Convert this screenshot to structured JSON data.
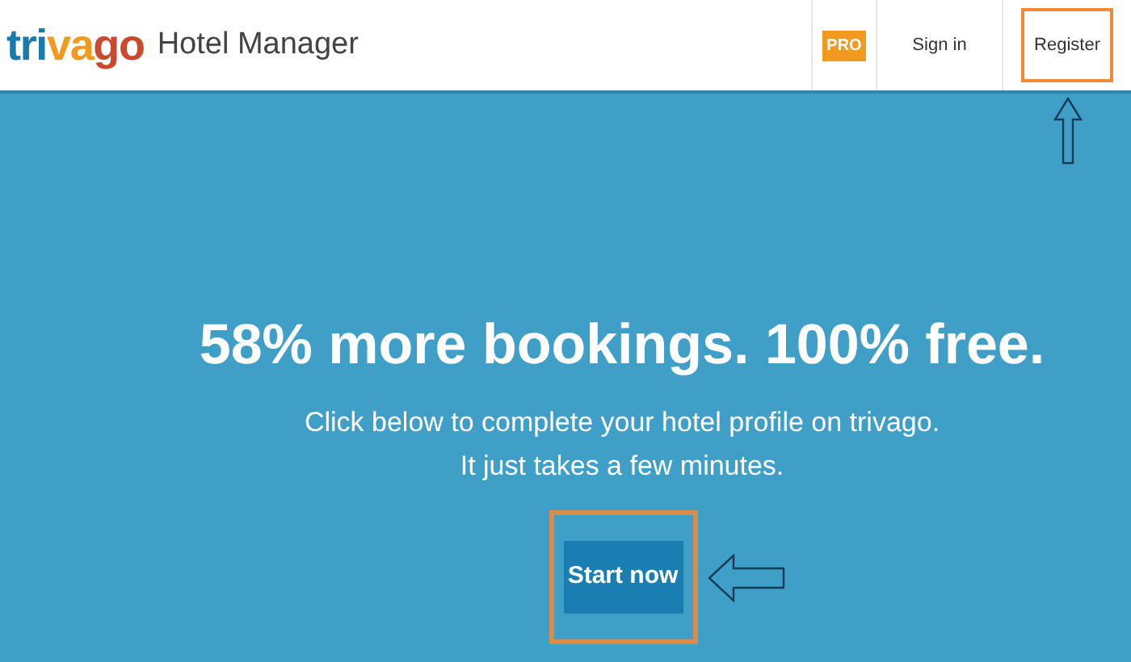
{
  "header": {
    "logo": [
      {
        "text": "tri",
        "color": "#1a7bab"
      },
      {
        "text": "va",
        "color": "#f29a1f"
      },
      {
        "text": "go",
        "color": "#c94a2e"
      }
    ],
    "product": "Hotel Manager",
    "nav": [
      {
        "kind": "badge",
        "label": "PRO"
      },
      {
        "kind": "link",
        "label": "Sign in",
        "highlighted": false
      },
      {
        "kind": "link",
        "label": "Register",
        "highlighted": true
      }
    ]
  },
  "hero": {
    "headline": "58% more bookings. 100% free.",
    "lines": [
      "Click below to complete your hotel profile on trivago.",
      "It just takes a few minutes."
    ],
    "button": {
      "label": "Start now",
      "highlighted": true
    }
  }
}
